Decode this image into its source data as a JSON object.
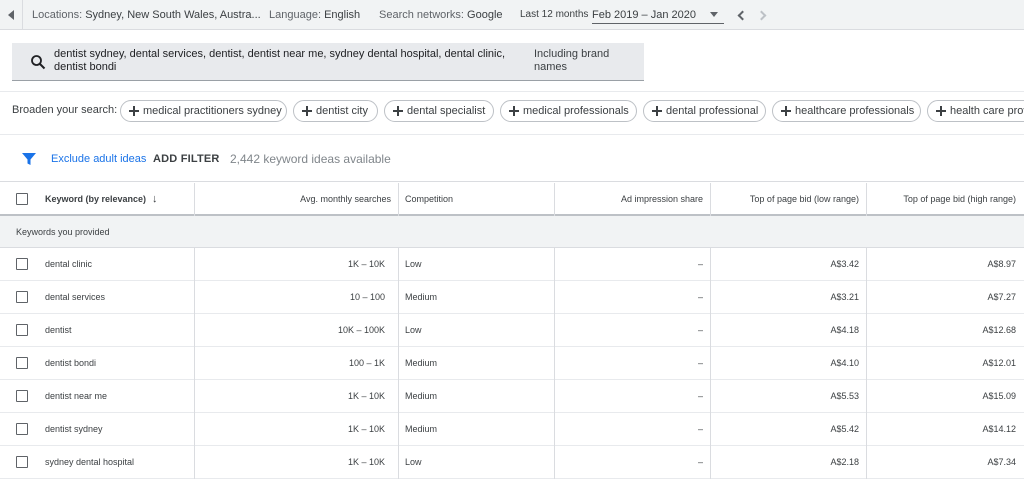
{
  "topbar": {
    "locations_label": "Locations:",
    "locations_value": "Sydney, New South Wales, Austra...",
    "language_label": "Language:",
    "language_value": "English",
    "networks_label": "Search networks:",
    "networks_value": "Google",
    "period_label": "Last 12 months",
    "date_range": "Feb 2019 – Jan 2020"
  },
  "search": {
    "query": "dentist sydney, dental services, dentist, dentist near me, sydney dental hospital, dental clinic, dentist bondi",
    "brand_option": "Including brand names"
  },
  "broaden": {
    "label": "Broaden your search:",
    "chips": [
      "medical practitioners sydney",
      "dentist city",
      "dental specialist",
      "medical professionals",
      "dental professional",
      "healthcare professionals",
      "health care providers"
    ]
  },
  "filters": {
    "exclude_adult": "Exclude adult ideas",
    "add_filter": "ADD FILTER",
    "ideas_count": "2,442 keyword ideas available"
  },
  "table": {
    "headers": {
      "keyword": "Keyword (by relevance)",
      "avg_monthly": "Avg. monthly searches",
      "competition": "Competition",
      "ad_impression": "Ad impression share",
      "bid_low": "Top of page bid (low range)",
      "bid_high": "Top of page bid (high range)"
    },
    "group_label": "Keywords you provided",
    "rows": [
      {
        "keyword": "dental clinic",
        "avg": "1K – 10K",
        "competition": "Low",
        "impression": "–",
        "low": "A$3.42",
        "high": "A$8.97"
      },
      {
        "keyword": "dental services",
        "avg": "10 – 100",
        "competition": "Medium",
        "impression": "–",
        "low": "A$3.21",
        "high": "A$7.27"
      },
      {
        "keyword": "dentist",
        "avg": "10K – 100K",
        "competition": "Low",
        "impression": "–",
        "low": "A$4.18",
        "high": "A$12.68"
      },
      {
        "keyword": "dentist bondi",
        "avg": "100 – 1K",
        "competition": "Medium",
        "impression": "–",
        "low": "A$4.10",
        "high": "A$12.01"
      },
      {
        "keyword": "dentist near me",
        "avg": "1K – 10K",
        "competition": "Medium",
        "impression": "–",
        "low": "A$5.53",
        "high": "A$15.09"
      },
      {
        "keyword": "dentist sydney",
        "avg": "1K – 10K",
        "competition": "Medium",
        "impression": "–",
        "low": "A$5.42",
        "high": "A$14.12"
      },
      {
        "keyword": "sydney dental hospital",
        "avg": "1K – 10K",
        "competition": "Low",
        "impression": "–",
        "low": "A$2.18",
        "high": "A$7.34"
      }
    ]
  },
  "icons": {
    "back": "triangle-left-icon",
    "search": "search-icon",
    "filter": "funnel-icon",
    "prev": "chevron-left-icon",
    "next": "chevron-right-icon",
    "plus": "plus-icon",
    "sort": "arrow-down-icon"
  },
  "colors": {
    "accent": "#1a73e8",
    "topbar_bg": "#f1f3f4",
    "search_bg": "#e8eaed",
    "group_bg": "#f1f3f4"
  }
}
